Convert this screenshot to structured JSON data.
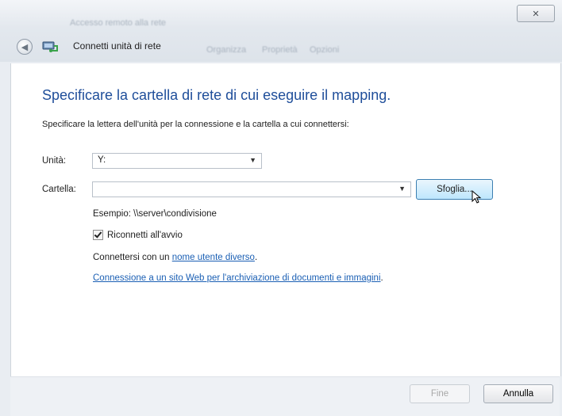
{
  "window": {
    "title": "Connetti unità di rete",
    "close_glyph": "✕"
  },
  "background_hints": [
    "Accesso remoto alla rete",
    "Organizza",
    "Proprietà",
    "Opzioni"
  ],
  "dialog": {
    "heading": "Specificare la cartella di rete di cui eseguire il mapping.",
    "subtext": "Specificare la lettera dell'unità per la connessione e la cartella a cui connettersi:",
    "drive_label": "Unità:",
    "drive_value": "Y:",
    "folder_label": "Cartella:",
    "folder_value": "",
    "browse_label": "Sfoglia...",
    "example_text": "Esempio: \\\\server\\condivisione",
    "reconnect_label": "Riconnetti all'avvio",
    "reconnect_checked": true,
    "connect_prefix": "Connettersi con un ",
    "connect_link": "nome utente diverso",
    "connect_suffix": ".",
    "archive_link": "Connessione a un sito Web per l'archiviazione di documenti e immagini",
    "archive_suffix": "."
  },
  "footer": {
    "finish_label": "Fine",
    "cancel_label": "Annulla"
  },
  "colors": {
    "heading": "#1f4e9a",
    "link": "#1a5fb4",
    "browse_highlight": "#bee6fd"
  }
}
